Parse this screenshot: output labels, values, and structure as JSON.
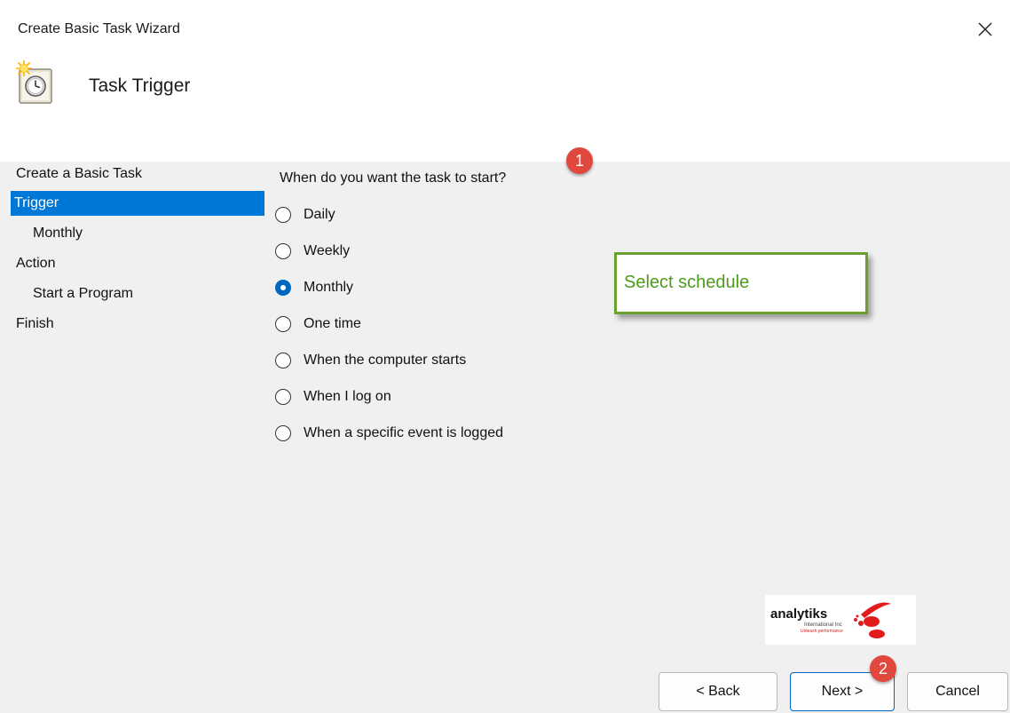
{
  "window": {
    "title": "Create Basic Task Wizard",
    "close_icon": "close-icon"
  },
  "header": {
    "title": "Task Trigger",
    "icon": "task-scheduler-icon"
  },
  "sidebar": {
    "items": [
      {
        "label": "Create a Basic Task",
        "level": 0,
        "active": false
      },
      {
        "label": "Trigger",
        "level": 0,
        "active": true
      },
      {
        "label": "Monthly",
        "level": 1,
        "active": false
      },
      {
        "label": "Action",
        "level": 0,
        "active": false
      },
      {
        "label": "Start a Program",
        "level": 1,
        "active": false
      },
      {
        "label": "Finish",
        "level": 0,
        "active": false
      }
    ]
  },
  "main": {
    "question": "When do you want the task to start?",
    "options": [
      {
        "label": "Daily",
        "checked": false
      },
      {
        "label": "Weekly",
        "checked": false
      },
      {
        "label": "Monthly",
        "checked": true
      },
      {
        "label": "One time",
        "checked": false
      },
      {
        "label": "When the computer starts",
        "checked": false
      },
      {
        "label": "When I log on",
        "checked": false
      },
      {
        "label": "When a specific event is logged",
        "checked": false
      }
    ],
    "selected_value": "Monthly"
  },
  "annotations": {
    "badge1": "1",
    "badge2": "2",
    "callout": "Select schedule"
  },
  "logo": {
    "brand": "analytiks",
    "sub1": "International Inc",
    "sub2": "Unleash performance"
  },
  "buttons": {
    "back": "< Back",
    "next": "Next >",
    "cancel": "Cancel"
  },
  "colors": {
    "accent": "#0078d7",
    "badge": "#e0483e",
    "callout_border": "#6aa12e",
    "callout_text": "#4e9a1d"
  }
}
